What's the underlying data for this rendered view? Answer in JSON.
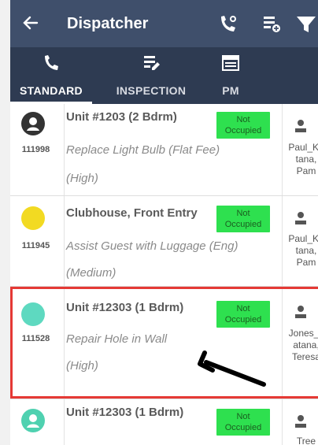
{
  "header": {
    "title": "Dispatcher",
    "back_icon": "arrow-left-icon",
    "call_icon": "phone-settings-icon",
    "add_icon": "list-add-icon",
    "filter_icon": "filter-icon"
  },
  "tabs": [
    {
      "label": "STANDARD",
      "icon": "phone-icon",
      "active": true
    },
    {
      "label": "INSPECTION",
      "icon": "clipboard-edit-icon",
      "active": false
    },
    {
      "label": "PM",
      "icon": "list-icon",
      "active": false
    }
  ],
  "work_orders": [
    {
      "id": "111998",
      "unit": "Unit #1203 (2 Bdrm)",
      "task": "Replace Light Bulb (Flat Fee)",
      "priority": "(High)",
      "occupancy": [
        "Not",
        "Occupied"
      ],
      "assignee": [
        "Paul_Ka",
        "tana,",
        "Pam"
      ],
      "status_color": "#333333",
      "status_icon": "person-circle-icon"
    },
    {
      "id": "111945",
      "unit": "Clubhouse, Front Entry",
      "task": "Assist Guest with Luggage (Eng)",
      "priority": "(Medium)",
      "occupancy": [
        "Not",
        "Occupied"
      ],
      "assignee": [
        "Paul_Ka",
        "tana,",
        "Pam"
      ],
      "status_color": "#f2da22"
    },
    {
      "id": "111528",
      "unit": "Unit #12303 (1 Bdrm)",
      "task": "Repair Hole in Wall",
      "priority": "(High)",
      "occupancy": [
        "Not",
        "Occupied"
      ],
      "assignee": [
        "Jones_k",
        "atana,",
        "Teresa"
      ],
      "status_color": "#5ed9c0"
    },
    {
      "id": "",
      "unit": "Unit #12303 (1 Bdrm)",
      "task": "",
      "priority": "",
      "occupancy": [
        "Not",
        "Occupied"
      ],
      "assignee": [
        "Tree",
        "",
        ""
      ],
      "status_color": "#4fd1b0",
      "status_icon": "person-circle-icon"
    }
  ],
  "colors": {
    "appbar": "#3f4f6b",
    "tabbar": "#2e3b52",
    "occupancy_badge": "#2ee04f",
    "highlight": "#e53935"
  }
}
